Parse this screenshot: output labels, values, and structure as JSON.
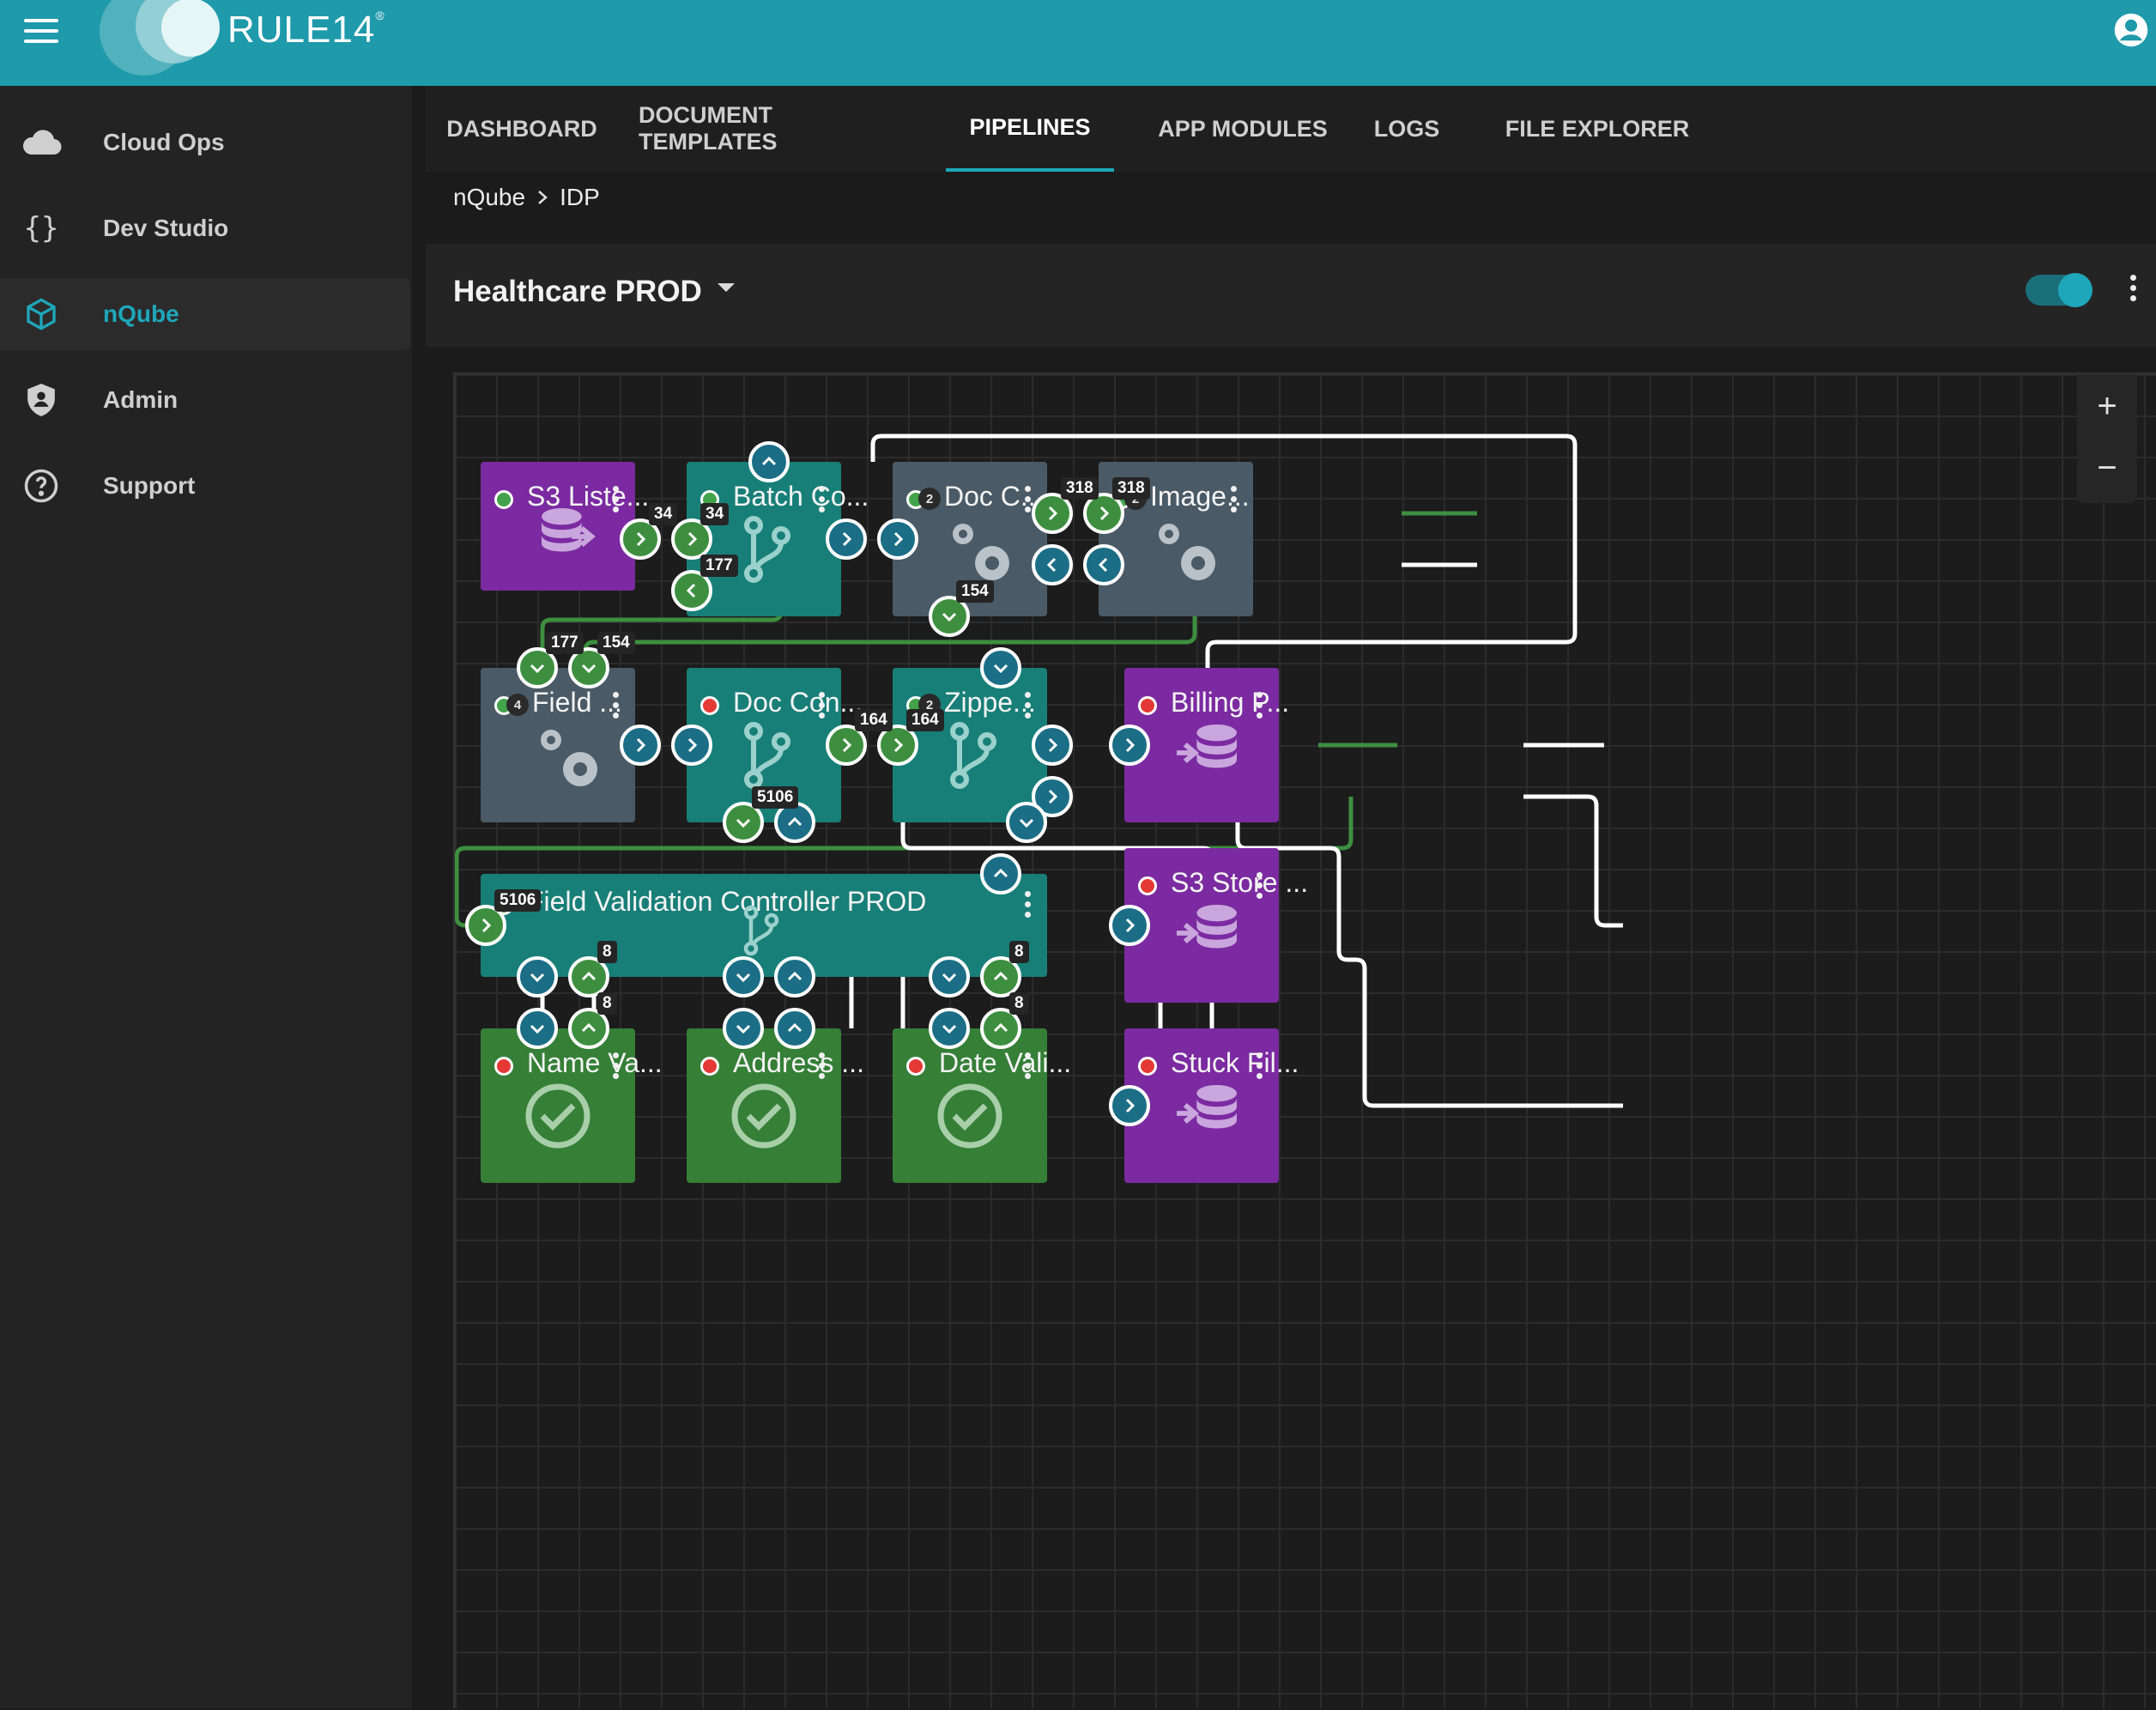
{
  "app": {
    "brand": "RULE14",
    "brand_mark": "®"
  },
  "sidebar": {
    "items": [
      {
        "label": "Cloud Ops",
        "icon": "cloud-icon"
      },
      {
        "label": "Dev Studio",
        "icon": "braces-icon"
      },
      {
        "label": "nQube",
        "icon": "cube-icon",
        "active": true
      },
      {
        "label": "Admin",
        "icon": "shield-icon"
      },
      {
        "label": "Support",
        "icon": "help-icon"
      }
    ]
  },
  "tabs": [
    {
      "label": "DASHBOARD"
    },
    {
      "label": "DOCUMENT TEMPLATES"
    },
    {
      "label": "PIPELINES",
      "active": true
    },
    {
      "label": "APP MODULES"
    },
    {
      "label": "LOGS"
    },
    {
      "label": "FILE EXPLORER"
    }
  ],
  "breadcrumb": {
    "root": "nQube",
    "current": "IDP"
  },
  "pipeline": {
    "title": "Healthcare PROD",
    "enabled": true
  },
  "zoom": {
    "plus": "+",
    "minus": "−"
  },
  "nodes": [
    {
      "id": "s3-listener",
      "label": "S3 Liste...",
      "color": "purple",
      "status": "ok",
      "icon": "database-import-icon"
    },
    {
      "id": "batch-controller",
      "label": "Batch Co...",
      "color": "teal",
      "status": "ok",
      "icon": "branch-icon"
    },
    {
      "id": "doc-classifier",
      "label": "Doc C...",
      "color": "gray",
      "status": "ok",
      "count": "2",
      "icon": "gears-icon"
    },
    {
      "id": "image-processor",
      "label": "Image...",
      "color": "gray",
      "status": "ok",
      "count": "2",
      "icon": "gears-icon"
    },
    {
      "id": "field-extractor",
      "label": "Field ...",
      "color": "gray",
      "status": "ok",
      "count": "4",
      "icon": "gears-icon"
    },
    {
      "id": "doc-controller",
      "label": "Doc Con...",
      "color": "teal",
      "status": "err",
      "icon": "branch-icon"
    },
    {
      "id": "zipper",
      "label": "Zippe...",
      "color": "teal",
      "status": "ok",
      "count": "2",
      "icon": "branch-icon"
    },
    {
      "id": "billing",
      "label": "Billing P...",
      "color": "purple",
      "status": "err",
      "icon": "database-export-icon"
    },
    {
      "id": "s3-store",
      "label": "S3 Store ...",
      "color": "purple",
      "status": "err",
      "icon": "database-export-icon"
    },
    {
      "id": "stuck-files",
      "label": "Stuck Fil...",
      "color": "purple",
      "status": "err",
      "icon": "database-export-icon"
    },
    {
      "id": "field-validation",
      "label": "Field Validation Controller PROD",
      "color": "teal",
      "status": "ok",
      "icon": "branch-icon"
    },
    {
      "id": "name-validator",
      "label": "Name Va...",
      "color": "green",
      "status": "err",
      "icon": "check-circle-icon"
    },
    {
      "id": "address-validator",
      "label": "Address ...",
      "color": "green",
      "status": "err",
      "icon": "check-circle-icon"
    },
    {
      "id": "date-validator",
      "label": "Date Vali...",
      "color": "green",
      "status": "err",
      "icon": "check-circle-icon"
    }
  ],
  "badges": {
    "s3_out": "34",
    "batch_in": "34",
    "batch_in2": "177",
    "docc_out": "318",
    "image_in": "318",
    "docc_down": "154",
    "field_in1": "177",
    "field_in2": "154",
    "doccon_out": "164",
    "zipper_in": "164",
    "doccon_down": "5106",
    "fv_in": "5106",
    "fv_name_up": "8",
    "name_up": "8",
    "fv_date_up": "8",
    "date_up": "8"
  }
}
